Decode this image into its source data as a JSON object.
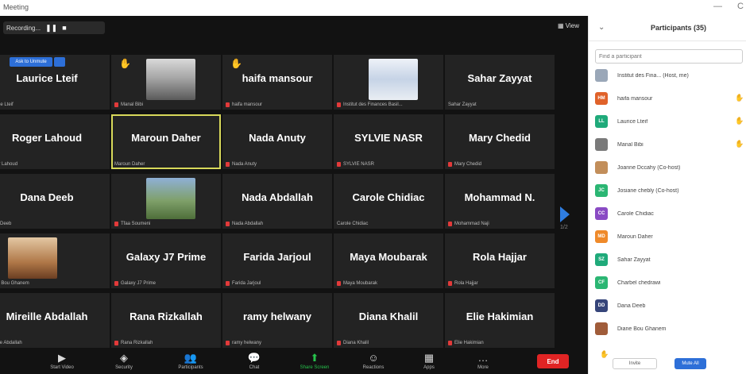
{
  "window": {
    "title": "Meeting",
    "minimize_label": "—",
    "close_label": "C"
  },
  "topbar": {
    "recording_label": "Recording...",
    "pause_glyph": "❚❚",
    "stop_glyph": "■",
    "view_label": "View"
  },
  "grid": {
    "tiles": [
      {
        "name": "Laurice Lteif",
        "label": "Laurice Lteif",
        "muted": false,
        "hand": false,
        "invite_label": "Ask to Unmute"
      },
      {
        "name": "",
        "label": "Manal Bibi",
        "muted": true,
        "hand": true,
        "photo": true
      },
      {
        "name": "haifa mansour",
        "label": "haifa mansour",
        "muted": true,
        "hand": true
      },
      {
        "name": "",
        "label": "Institut des Finances Basil...",
        "muted": true,
        "hand": false,
        "photo": true
      },
      {
        "name": "Sahar Zayyat",
        "label": "Sahar Zayyat",
        "muted": false,
        "hand": false
      },
      {
        "name": "Roger Lahoud",
        "label": "Roger Lahoud",
        "muted": false,
        "hand": false
      },
      {
        "name": "Maroun Daher",
        "label": "Maroun Daher",
        "muted": false,
        "hand": false,
        "active": true
      },
      {
        "name": "Nada Anuty",
        "label": "Nada Anuty",
        "muted": true,
        "hand": false
      },
      {
        "name": "SYLVIE NASR",
        "label": "SYLVIE NASR",
        "muted": true,
        "hand": false
      },
      {
        "name": "Mary Chedid",
        "label": "Mary Chedid",
        "muted": true,
        "hand": false
      },
      {
        "name": "Dana Deeb",
        "label": "Dana Deeb",
        "muted": false,
        "hand": false
      },
      {
        "name": "",
        "label": "Tfaa Soumeni",
        "muted": true,
        "hand": false,
        "photo": true
      },
      {
        "name": "Nada Abdallah",
        "label": "Nada Abdallah",
        "muted": true,
        "hand": false
      },
      {
        "name": "Carole Chidiac",
        "label": "Carole Chidiac",
        "muted": false,
        "hand": false
      },
      {
        "name": "Mohammad N.",
        "label": "Mohammad Naji",
        "muted": true,
        "hand": false
      },
      {
        "name": "",
        "label": "Diane Bou Ghanem",
        "muted": false,
        "hand": false,
        "photo": true
      },
      {
        "name": "Galaxy J7 Prime",
        "label": "Galaxy J7 Prime",
        "muted": true,
        "hand": false
      },
      {
        "name": "Farida Jarjoul",
        "label": "Farida Jarjoul",
        "muted": true,
        "hand": false
      },
      {
        "name": "Maya Moubarak",
        "label": "Maya Moubarak",
        "muted": true,
        "hand": false
      },
      {
        "name": "Rola Hajjar",
        "label": "Rola Hajjar",
        "muted": true,
        "hand": false
      },
      {
        "name": "Mireille Abdallah",
        "label": "Mireille Abdallah",
        "muted": false,
        "hand": false
      },
      {
        "name": "Rana Rizkallah",
        "label": "Rana Rizkallah",
        "muted": true,
        "hand": false
      },
      {
        "name": "ramy helwany",
        "label": "ramy helwany",
        "muted": true,
        "hand": false
      },
      {
        "name": "Diana Khalil",
        "label": "Diana Khalil",
        "muted": true,
        "hand": false
      },
      {
        "name": "Elie Hakimian",
        "label": "Elie Hakimian",
        "muted": true,
        "hand": false
      }
    ],
    "page_indicator": "1/2"
  },
  "toolbar": {
    "buttons": [
      {
        "icon": "video-icon",
        "glyph": "▶",
        "label": "Start Video"
      },
      {
        "icon": "shield-icon",
        "glyph": "◈",
        "label": "Security"
      },
      {
        "icon": "participants-icon",
        "glyph": "👥",
        "label": "Participants"
      },
      {
        "icon": "chat-icon",
        "glyph": "💬",
        "label": "Chat"
      },
      {
        "icon": "share-screen-icon",
        "glyph": "⬆",
        "label": "Share Screen"
      },
      {
        "icon": "reactions-icon",
        "glyph": "☺",
        "label": "Reactions"
      },
      {
        "icon": "apps-icon",
        "glyph": "▦",
        "label": "Apps"
      },
      {
        "icon": "more-icon",
        "glyph": "…",
        "label": "More"
      }
    ],
    "end_label": "End"
  },
  "panel": {
    "title": "Participants (35)",
    "search_placeholder": "Find a participant",
    "participants": [
      {
        "initials": "",
        "name": "Institut des Fina... (Host, me)",
        "color": "#9aa7b8",
        "hand": false
      },
      {
        "initials": "HM",
        "name": "haifa mansour",
        "color": "#e0622a",
        "hand": true
      },
      {
        "initials": "LL",
        "name": "Laurice Lteif",
        "color": "#1faa7a",
        "hand": true
      },
      {
        "initials": "",
        "name": "Manal Bibi",
        "color": "#7a7a7a",
        "hand": true
      },
      {
        "initials": "",
        "name": "Joanne Dccahy (Co-host)",
        "color": "#c28e5a",
        "hand": false
      },
      {
        "initials": "JC",
        "name": "Josiane chebly (Co-host)",
        "color": "#2bb673",
        "hand": false
      },
      {
        "initials": "CC",
        "name": "Carole Chidiac",
        "color": "#8a4bc4",
        "hand": false
      },
      {
        "initials": "MD",
        "name": "Maroun Daher",
        "color": "#ef8a2a",
        "hand": false
      },
      {
        "initials": "SZ",
        "name": "Sahar Zayyat",
        "color": "#1faa7a",
        "hand": false
      },
      {
        "initials": "CF",
        "name": "Charbel chedrawi",
        "color": "#2bb673",
        "hand": false
      },
      {
        "initials": "DD",
        "name": "Dana Deeb",
        "color": "#36457a",
        "hand": false
      },
      {
        "initials": "",
        "name": "Diane Bou Ghanem",
        "color": "#a05c3a",
        "hand": false
      }
    ],
    "invite_label": "Invite",
    "mute_all_label": "Mute All"
  }
}
